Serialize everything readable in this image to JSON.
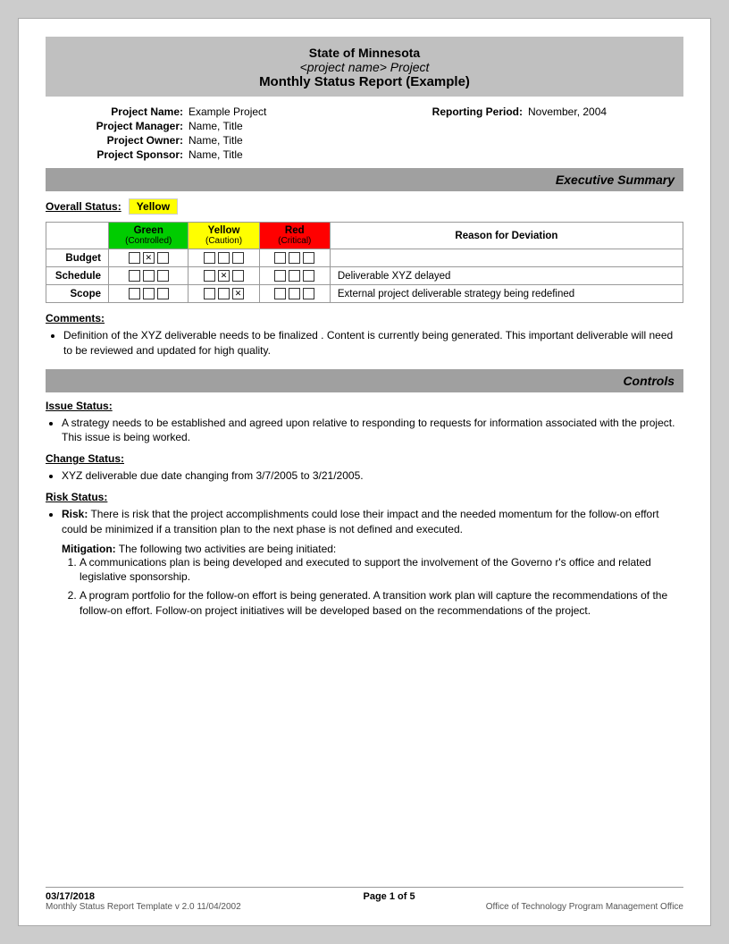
{
  "header": {
    "line1": "State of Minnesota",
    "line2": "<project name> Project",
    "line3": "Monthly Status Report (Example)"
  },
  "project_info": {
    "project_name_label": "Project Name:",
    "project_name_value": "Example Project",
    "reporting_period_label": "Reporting Period:",
    "reporting_period_value": "November, 2004",
    "project_manager_label": "Project Manager:",
    "project_manager_value": "Name, Title",
    "project_owner_label": "Project Owner:",
    "project_owner_value": "Name, Title",
    "project_sponsor_label": "Project Sponsor:",
    "project_sponsor_value": "Name, Title"
  },
  "executive_summary": {
    "section_title": "Executive Summary",
    "overall_status_label": "Overall Status:",
    "overall_status_value": "Yellow",
    "table": {
      "headers": {
        "green_label": "Green",
        "green_sub": "(Controlled)",
        "yellow_label": "Yellow",
        "yellow_sub": "(Caution)",
        "red_label": "Red",
        "red_sub": "(Critical)",
        "reason_label": "Reason for Deviation"
      },
      "rows": [
        {
          "label": "Budget",
          "green": [
            false,
            true,
            false
          ],
          "yellow": [
            false,
            false,
            false
          ],
          "red": [
            false,
            false,
            false
          ],
          "reason": ""
        },
        {
          "label": "Schedule",
          "green": [
            false,
            false,
            false
          ],
          "yellow": [
            false,
            true,
            false
          ],
          "red": [
            false,
            false,
            false
          ],
          "reason": "Deliverable XYZ delayed"
        },
        {
          "label": "Scope",
          "green": [
            false,
            false,
            false
          ],
          "yellow": [
            false,
            false,
            true
          ],
          "red": [
            false,
            false,
            false
          ],
          "reason": "External project deliverable strategy being redefined"
        }
      ]
    },
    "comments_label": "Comments:",
    "comments_bullet": "Definition of the XYZ deliverable  needs to be finalized .  Content is currently being generated.  This important deliverable will need to be reviewed and updated for high quality."
  },
  "controls": {
    "section_title": "Controls",
    "issue_status_label": "Issue Status:",
    "issue_bullet": "A strategy needs to be established and agreed upon relative to  responding to  requests for information associated with the project.  This issue is being worked.",
    "change_status_label": "Change Status:",
    "change_bullet": "XYZ deliverable due date changing from   3/7/2005 to 3/21/2005.",
    "risk_status_label": "Risk Status:",
    "risk_bullet_label": "Risk:",
    "risk_bullet_text": "There is risk that the project accomplishments could lose their impact and the needed momentum for the follow-on effort could be   minimized if a transition plan to the next phase is not defined and executed.",
    "mitigation_label": "Mitigation:",
    "mitigation_intro": "The following two activities are being initiated:",
    "mitigation_items": [
      "A communications plan is being developed and executed to support the involvement of the Governo r's office and related legislative sponsorship.",
      "A program portfolio for the follow-on effort is being generated.  A transition work plan will capture the recommendations of the follow-on effort. Follow-on project initiatives will be developed based on the recommendations of the project."
    ]
  },
  "footer": {
    "date": "03/17/2018",
    "page": "Page 1 of 5",
    "template_info": "Monthly Status Report Template  v 2.0  11/04/2002",
    "office": "Office of Technology Program Management Office"
  }
}
